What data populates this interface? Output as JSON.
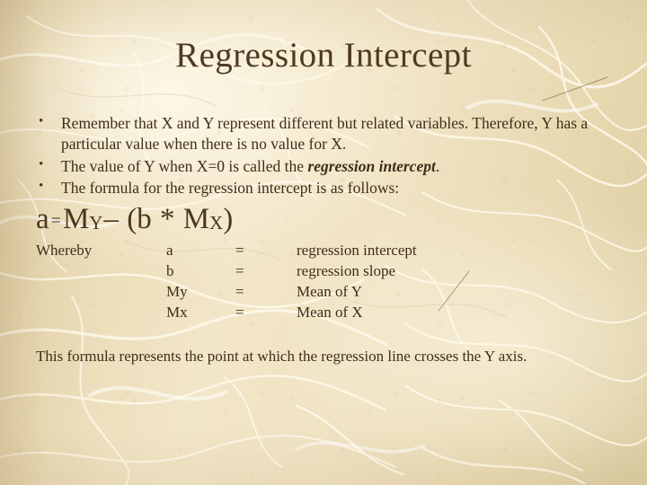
{
  "slide": {
    "title": "Regression Intercept",
    "background_color": "#eee0bd",
    "text_color": "#3f2d1a",
    "title_color": "#4f3a20",
    "bullet_glyph": "•",
    "bullets": [
      {
        "parts": [
          {
            "text": "Remember that X and Y represent different but related variables. Therefore, Y has a particular value when there is no value for X.",
            "style": "normal"
          }
        ]
      },
      {
        "parts": [
          {
            "text": "The value of Y when X=0 is called the ",
            "style": "normal"
          },
          {
            "text": "regression intercept",
            "style": "bold-italic"
          },
          {
            "text": ".",
            "style": "normal"
          }
        ]
      },
      {
        "parts": [
          {
            "text": "The formula for the regression intercept is as follows:",
            "style": "normal"
          }
        ]
      }
    ],
    "formula": {
      "lhs": "a",
      "equals": "=",
      "term1_base": "M",
      "term1_sub": "Y",
      "minus": "–",
      "open_paren": "(",
      "term2": "b",
      "times": "*",
      "term3_base": "M",
      "term3_sub": "X",
      "close_paren": ")",
      "plain_text": "a = MY – (b * MX)"
    },
    "definitions": {
      "lead_label": "Whereby",
      "rows": [
        {
          "symbol": "a",
          "equals": "=",
          "meaning": "regression intercept"
        },
        {
          "symbol": "b",
          "equals": "=",
          "meaning": "regression slope"
        },
        {
          "symbol": "My",
          "equals": "=",
          "meaning": "Mean of Y"
        },
        {
          "symbol": "Mx",
          "equals": "=",
          "meaning": "Mean of X"
        }
      ]
    },
    "closing_text": "This formula represents the point at which the regression line crosses the Y axis."
  }
}
